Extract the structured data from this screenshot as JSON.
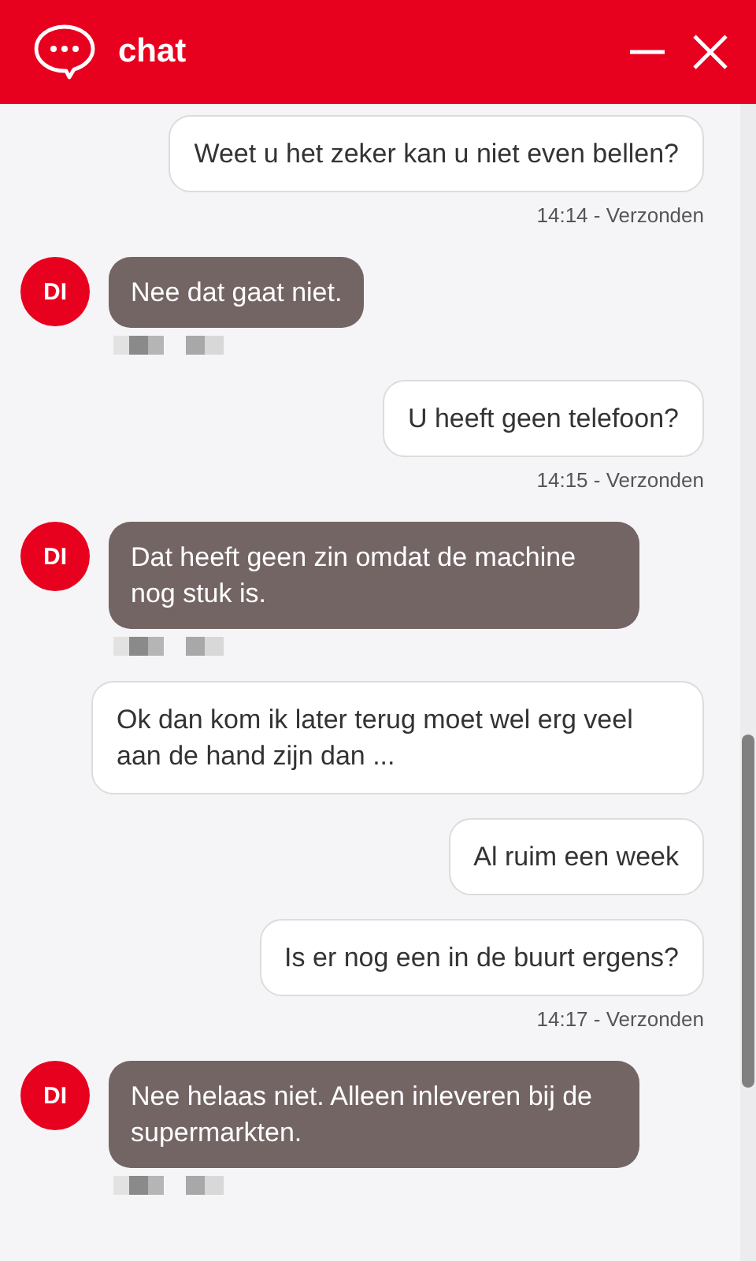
{
  "header": {
    "title": "chat"
  },
  "messages": [
    {
      "kind": "user",
      "text": "Weet u het zeker kan u niet even bellen?",
      "status": "14:14 - Verzonden"
    },
    {
      "kind": "agent",
      "avatar": "DI",
      "text": "Nee dat gaat niet."
    },
    {
      "kind": "user",
      "text": "U heeft geen telefoon?",
      "status": "14:15 - Verzonden"
    },
    {
      "kind": "agent",
      "avatar": "DI",
      "text": "Dat heeft geen zin omdat de machine nog stuk is."
    },
    {
      "kind": "user",
      "text": "Ok dan kom ik later terug moet wel erg veel aan de hand zijn dan ..."
    },
    {
      "kind": "user",
      "text": "Al ruim een week"
    },
    {
      "kind": "user",
      "text": "Is er nog een in de buurt ergens?",
      "status": "14:17 - Verzonden"
    },
    {
      "kind": "agent",
      "avatar": "DI",
      "text": "Nee helaas niet. Alleen inleveren bij de supermarkten."
    }
  ]
}
